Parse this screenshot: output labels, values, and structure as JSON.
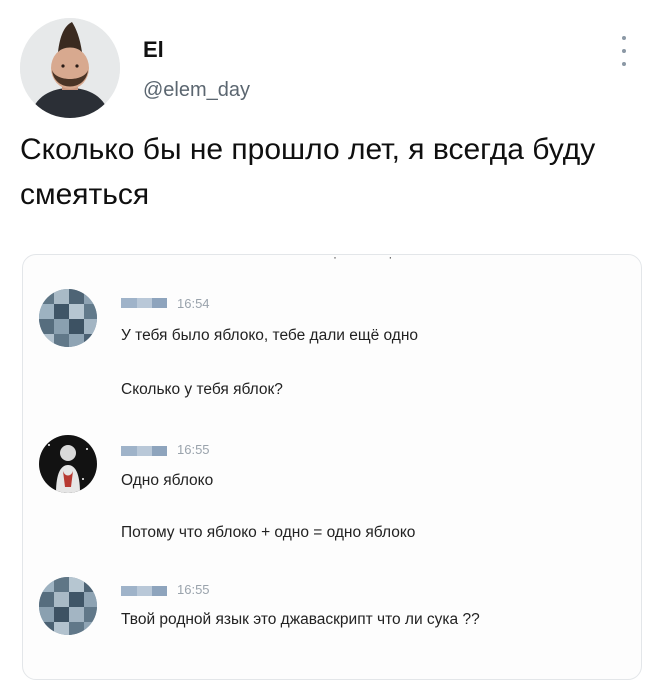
{
  "author": {
    "name": "El",
    "handle": "@elem_day"
  },
  "tweet": {
    "text": "Сколько бы не прошло лет, я всегда буду смеяться"
  },
  "chat": {
    "messages": [
      {
        "time": "16:54",
        "lines": [
          "У тебя было яблоко, тебе дали ещё одно",
          "Сколько у тебя яблок?"
        ]
      },
      {
        "time": "16:55",
        "lines": [
          "Одно яблоко",
          "Потому что яблоко + одно = одно яблоко"
        ]
      },
      {
        "time": "16:55",
        "lines": [
          "Твой родной язык это джаваскрипт что ли сука ??"
        ]
      }
    ]
  },
  "icons": {
    "more": "more-vertical-icon"
  },
  "colors": {
    "handle": "#5b6670",
    "card_border": "#e3e6e9",
    "timestamp": "#9aa3ac",
    "pixelated_name": "#9fb3c9"
  }
}
